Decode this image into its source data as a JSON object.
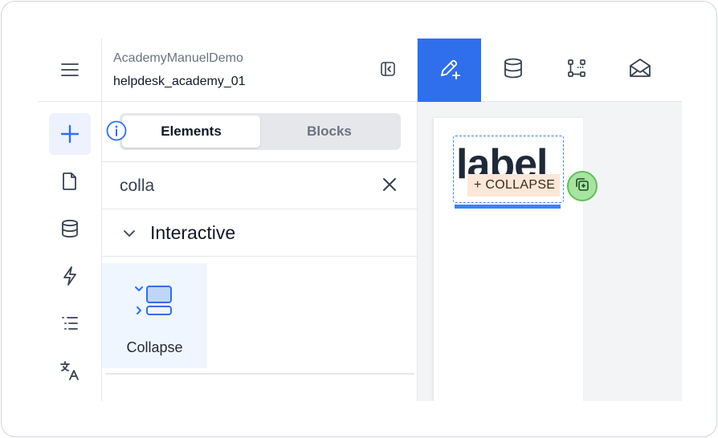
{
  "panel": {
    "app_name": "AcademyManuelDemo",
    "db_name": "helpdesk_academy_01",
    "tabs": [
      {
        "label": "Elements",
        "active": true
      },
      {
        "label": "Blocks",
        "active": false
      }
    ],
    "search": {
      "value": "colla",
      "placeholder": ""
    },
    "group": {
      "label": "Interactive",
      "expanded": true
    },
    "components": [
      {
        "label": "Collapse",
        "icon": "collapse-component-icon"
      }
    ]
  },
  "rail": {
    "items": [
      {
        "icon": "plus-icon",
        "active": true
      },
      {
        "icon": "file-icon",
        "active": false
      },
      {
        "icon": "database-icon",
        "active": false
      },
      {
        "icon": "lightning-icon",
        "active": false
      },
      {
        "icon": "list-icon",
        "active": false
      },
      {
        "icon": "translate-icon",
        "active": false
      }
    ]
  },
  "toolbar": {
    "tools": [
      {
        "icon": "edit-pen-icon",
        "active": true
      },
      {
        "icon": "database-icon",
        "active": false
      },
      {
        "icon": "workflow-icon",
        "active": false
      },
      {
        "icon": "mail-icon",
        "active": false
      }
    ]
  },
  "canvas": {
    "label_text": "label",
    "drag_chip_text": "+ COLLAPSE"
  },
  "colors": {
    "accent": "#2f6fec",
    "selection": "#3b82f6",
    "drop_badge": "#a7e4a2",
    "drag_chip": "#fde7d6",
    "tile_bg": "#eff6ff"
  }
}
